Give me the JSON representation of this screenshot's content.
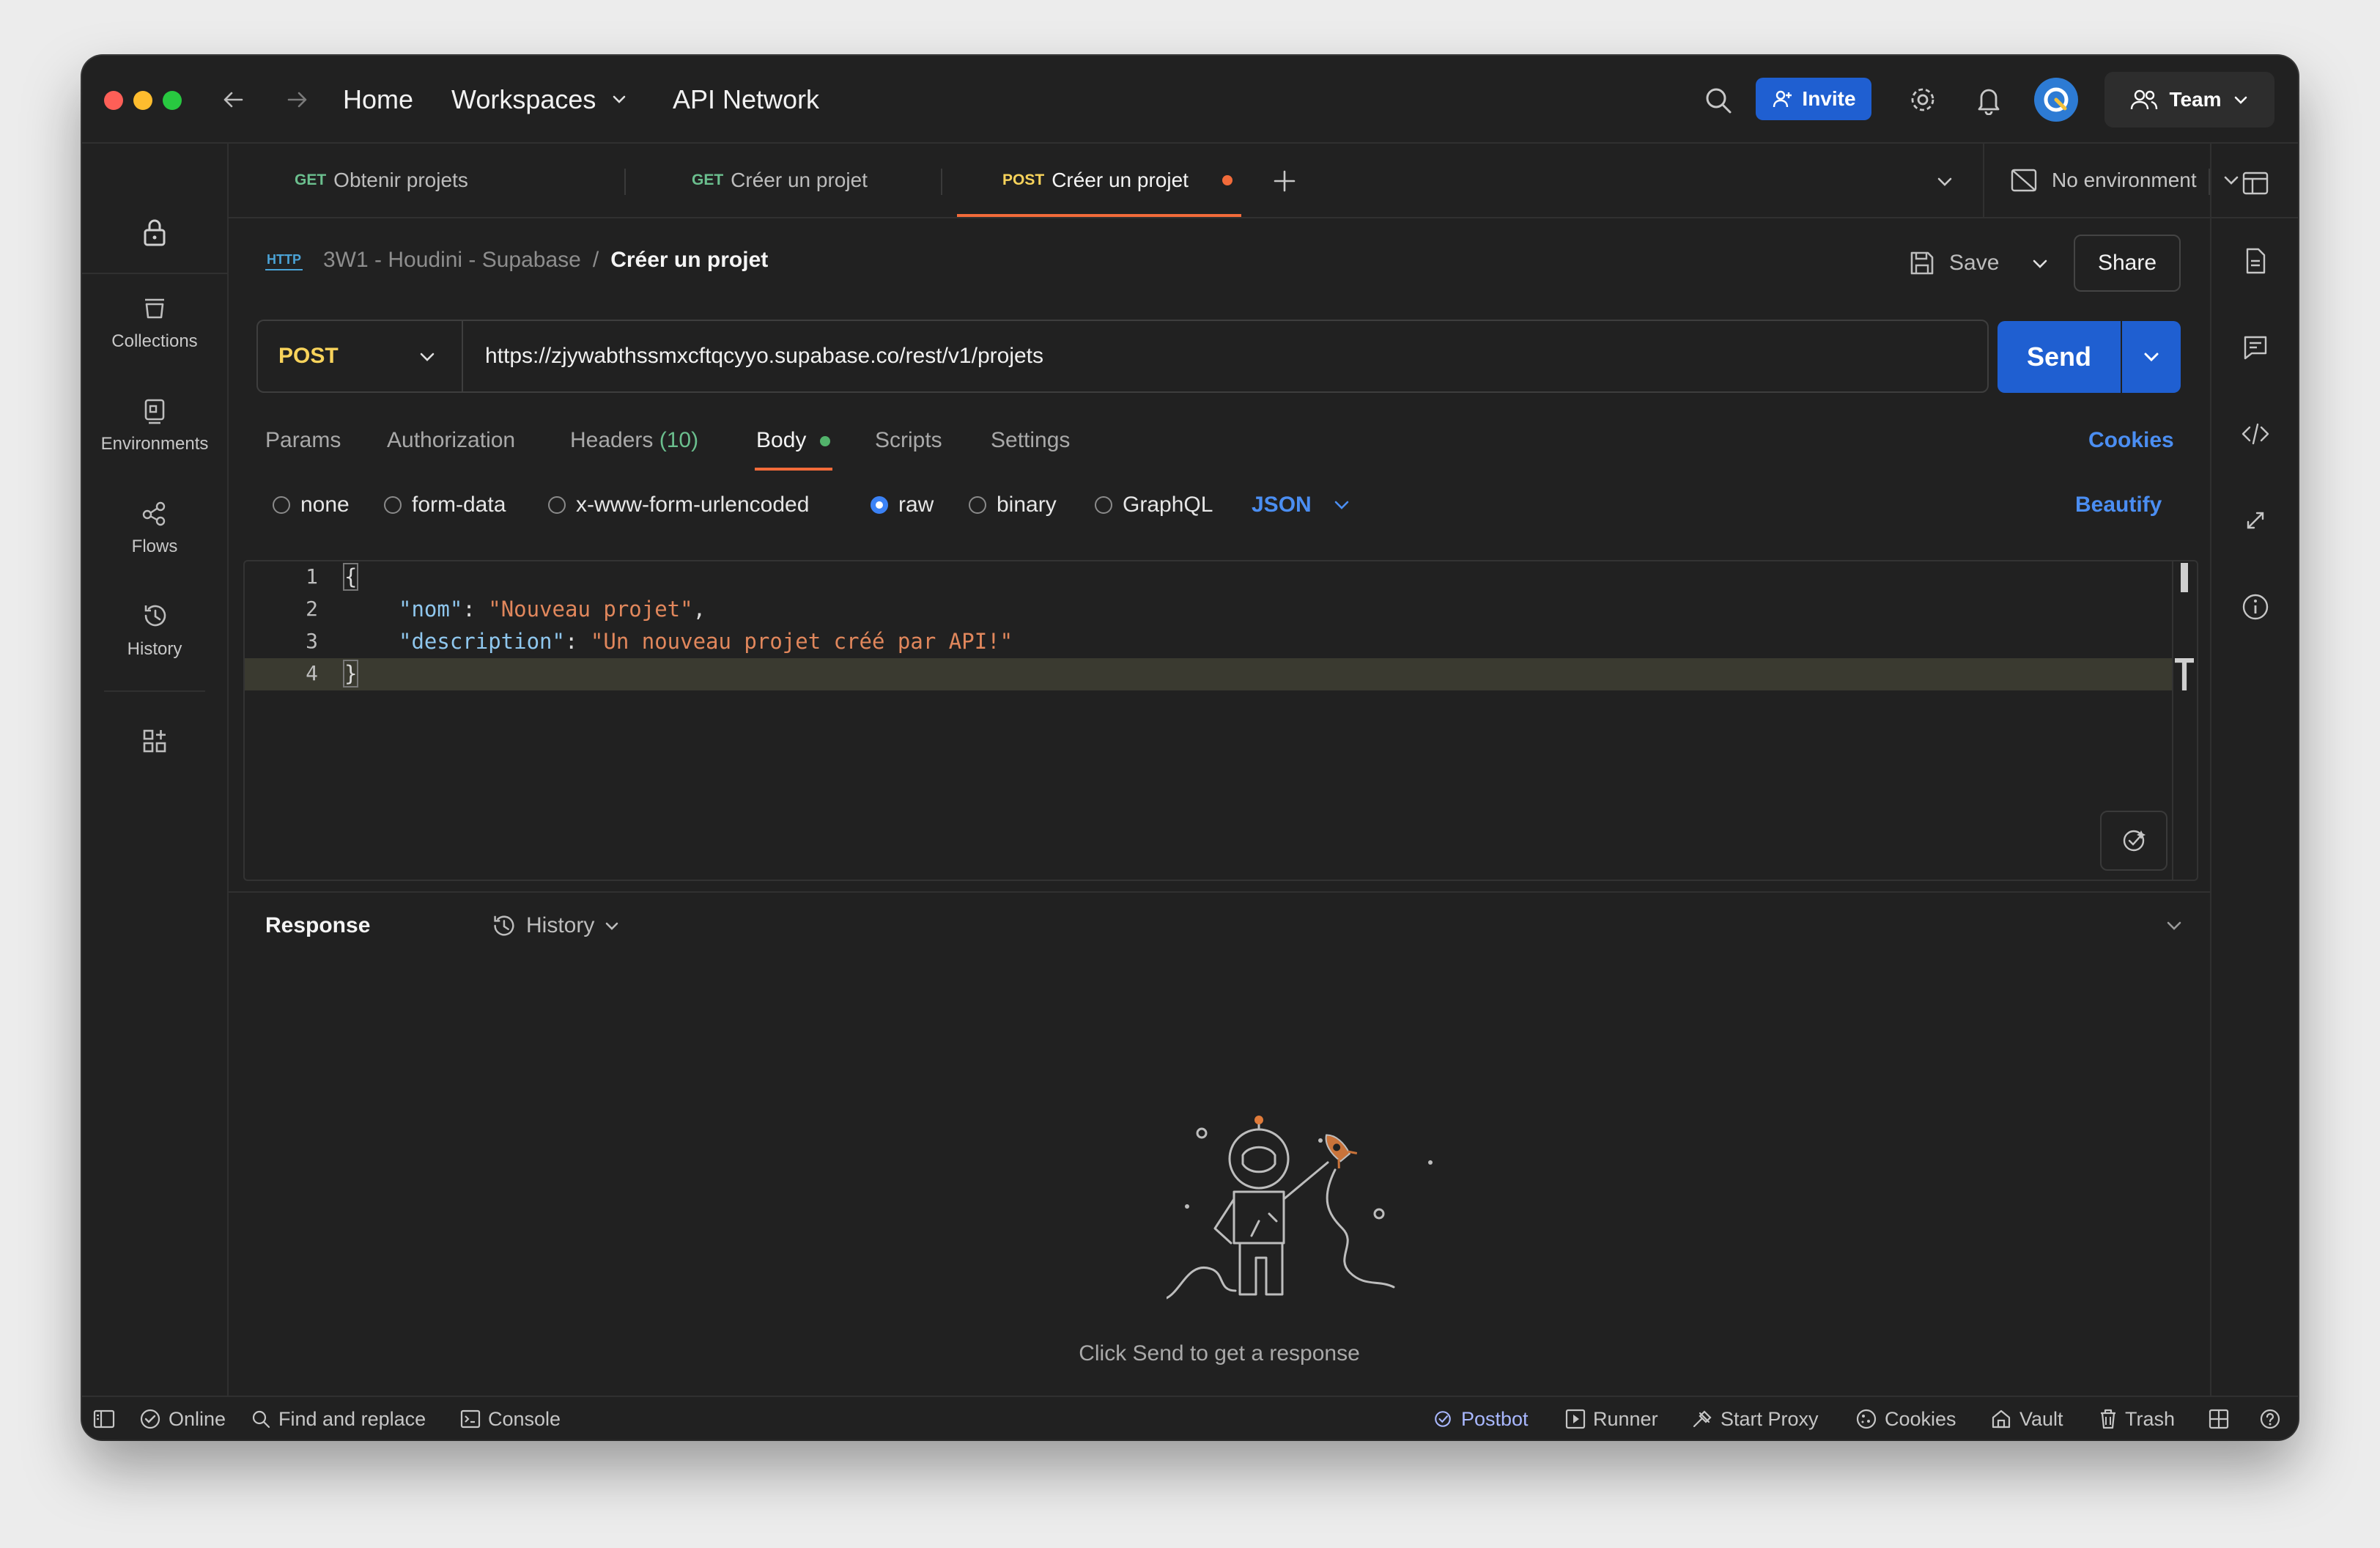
{
  "nav": {
    "home": "Home",
    "workspaces": "Workspaces",
    "api_network": "API Network",
    "invite": "Invite",
    "team": "Team"
  },
  "sidebar": {
    "items": [
      {
        "label": "Collections"
      },
      {
        "label": "Environments"
      },
      {
        "label": "Flows"
      },
      {
        "label": "History"
      }
    ]
  },
  "tabs": [
    {
      "method": "GET",
      "name": "Obtenir projets"
    },
    {
      "method": "GET",
      "name": "Créer un projet"
    },
    {
      "method": "POST",
      "name": "Créer un projet"
    }
  ],
  "environment": "No environment",
  "breadcrumb": {
    "badge": "HTTP",
    "collection": "3W1 - Houdini - Supabase",
    "separator": "/",
    "request": "Créer un projet"
  },
  "actions": {
    "save": "Save",
    "share": "Share"
  },
  "request": {
    "method": "POST",
    "url": "https://zjywabthssmxcftqcyyo.supabase.co/rest/v1/projets",
    "send": "Send"
  },
  "request_tabs": {
    "params": "Params",
    "authorization": "Authorization",
    "headers": "Headers",
    "headers_count": "(10)",
    "body": "Body",
    "scripts": "Scripts",
    "settings": "Settings",
    "cookies": "Cookies"
  },
  "body_types": {
    "none": "none",
    "form_data": "form-data",
    "urlencoded": "x-www-form-urlencoded",
    "raw": "raw",
    "binary": "binary",
    "graphql": "GraphQL",
    "format": "JSON",
    "beautify": "Beautify",
    "selected": "raw"
  },
  "editor": {
    "line_numbers": [
      "1",
      "2",
      "3",
      "4"
    ],
    "open_brace": "{",
    "close_brace": "}",
    "key1": "\"nom\"",
    "val1": "\"Nouveau projet\"",
    "key2": "\"description\"",
    "val2": "\"Un nouveau projet créé par API!\"",
    "colon": ": ",
    "comma": ","
  },
  "response": {
    "title": "Response",
    "history": "History",
    "empty_message": "Click Send to get a response"
  },
  "statusbar": {
    "online": "Online",
    "find_replace": "Find and replace",
    "console": "Console",
    "postbot": "Postbot",
    "runner": "Runner",
    "start_proxy": "Start Proxy",
    "cookies": "Cookies",
    "vault": "Vault",
    "trash": "Trash"
  },
  "colors": {
    "accent": "#1f5fd1",
    "link": "#4b8ef2",
    "post_method": "#f8d35b",
    "get_method": "#6bbf8e",
    "active_tab_underline": "#f26b3a",
    "json_key": "#8fc7ee",
    "json_string": "#e1875c",
    "headers_count": "#6bbf8e"
  }
}
